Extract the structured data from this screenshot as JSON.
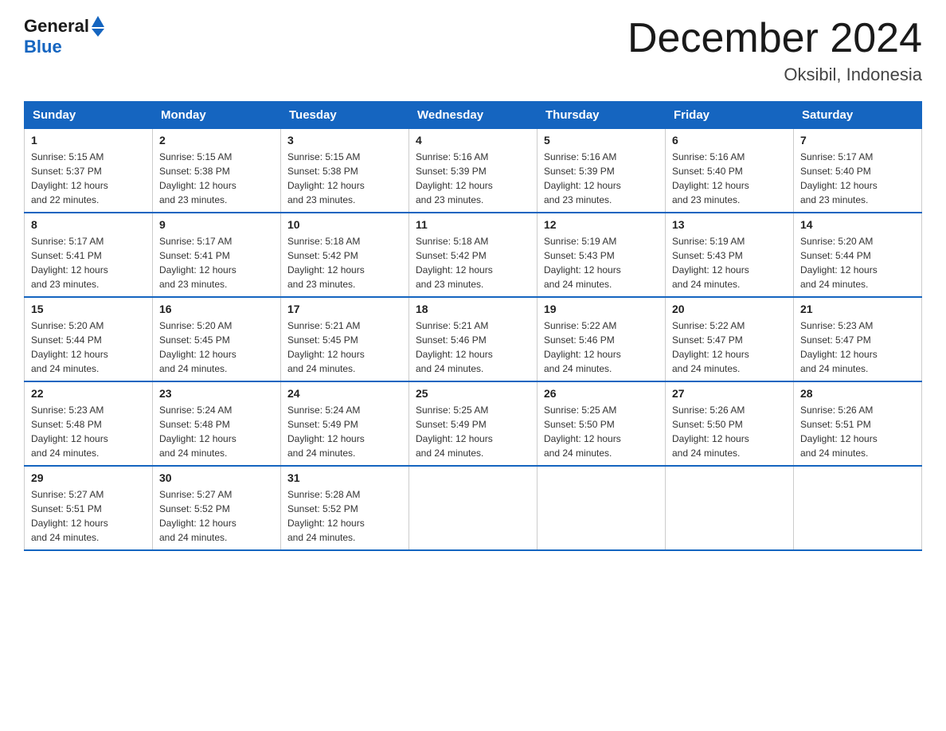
{
  "header": {
    "logo": {
      "general": "General",
      "blue": "Blue"
    },
    "title": "December 2024",
    "location": "Oksibil, Indonesia"
  },
  "days_of_week": [
    "Sunday",
    "Monday",
    "Tuesday",
    "Wednesday",
    "Thursday",
    "Friday",
    "Saturday"
  ],
  "weeks": [
    [
      {
        "day": "1",
        "sunrise": "5:15 AM",
        "sunset": "5:37 PM",
        "daylight": "12 hours and 22 minutes."
      },
      {
        "day": "2",
        "sunrise": "5:15 AM",
        "sunset": "5:38 PM",
        "daylight": "12 hours and 23 minutes."
      },
      {
        "day": "3",
        "sunrise": "5:15 AM",
        "sunset": "5:38 PM",
        "daylight": "12 hours and 23 minutes."
      },
      {
        "day": "4",
        "sunrise": "5:16 AM",
        "sunset": "5:39 PM",
        "daylight": "12 hours and 23 minutes."
      },
      {
        "day": "5",
        "sunrise": "5:16 AM",
        "sunset": "5:39 PM",
        "daylight": "12 hours and 23 minutes."
      },
      {
        "day": "6",
        "sunrise": "5:16 AM",
        "sunset": "5:40 PM",
        "daylight": "12 hours and 23 minutes."
      },
      {
        "day": "7",
        "sunrise": "5:17 AM",
        "sunset": "5:40 PM",
        "daylight": "12 hours and 23 minutes."
      }
    ],
    [
      {
        "day": "8",
        "sunrise": "5:17 AM",
        "sunset": "5:41 PM",
        "daylight": "12 hours and 23 minutes."
      },
      {
        "day": "9",
        "sunrise": "5:17 AM",
        "sunset": "5:41 PM",
        "daylight": "12 hours and 23 minutes."
      },
      {
        "day": "10",
        "sunrise": "5:18 AM",
        "sunset": "5:42 PM",
        "daylight": "12 hours and 23 minutes."
      },
      {
        "day": "11",
        "sunrise": "5:18 AM",
        "sunset": "5:42 PM",
        "daylight": "12 hours and 23 minutes."
      },
      {
        "day": "12",
        "sunrise": "5:19 AM",
        "sunset": "5:43 PM",
        "daylight": "12 hours and 24 minutes."
      },
      {
        "day": "13",
        "sunrise": "5:19 AM",
        "sunset": "5:43 PM",
        "daylight": "12 hours and 24 minutes."
      },
      {
        "day": "14",
        "sunrise": "5:20 AM",
        "sunset": "5:44 PM",
        "daylight": "12 hours and 24 minutes."
      }
    ],
    [
      {
        "day": "15",
        "sunrise": "5:20 AM",
        "sunset": "5:44 PM",
        "daylight": "12 hours and 24 minutes."
      },
      {
        "day": "16",
        "sunrise": "5:20 AM",
        "sunset": "5:45 PM",
        "daylight": "12 hours and 24 minutes."
      },
      {
        "day": "17",
        "sunrise": "5:21 AM",
        "sunset": "5:45 PM",
        "daylight": "12 hours and 24 minutes."
      },
      {
        "day": "18",
        "sunrise": "5:21 AM",
        "sunset": "5:46 PM",
        "daylight": "12 hours and 24 minutes."
      },
      {
        "day": "19",
        "sunrise": "5:22 AM",
        "sunset": "5:46 PM",
        "daylight": "12 hours and 24 minutes."
      },
      {
        "day": "20",
        "sunrise": "5:22 AM",
        "sunset": "5:47 PM",
        "daylight": "12 hours and 24 minutes."
      },
      {
        "day": "21",
        "sunrise": "5:23 AM",
        "sunset": "5:47 PM",
        "daylight": "12 hours and 24 minutes."
      }
    ],
    [
      {
        "day": "22",
        "sunrise": "5:23 AM",
        "sunset": "5:48 PM",
        "daylight": "12 hours and 24 minutes."
      },
      {
        "day": "23",
        "sunrise": "5:24 AM",
        "sunset": "5:48 PM",
        "daylight": "12 hours and 24 minutes."
      },
      {
        "day": "24",
        "sunrise": "5:24 AM",
        "sunset": "5:49 PM",
        "daylight": "12 hours and 24 minutes."
      },
      {
        "day": "25",
        "sunrise": "5:25 AM",
        "sunset": "5:49 PM",
        "daylight": "12 hours and 24 minutes."
      },
      {
        "day": "26",
        "sunrise": "5:25 AM",
        "sunset": "5:50 PM",
        "daylight": "12 hours and 24 minutes."
      },
      {
        "day": "27",
        "sunrise": "5:26 AM",
        "sunset": "5:50 PM",
        "daylight": "12 hours and 24 minutes."
      },
      {
        "day": "28",
        "sunrise": "5:26 AM",
        "sunset": "5:51 PM",
        "daylight": "12 hours and 24 minutes."
      }
    ],
    [
      {
        "day": "29",
        "sunrise": "5:27 AM",
        "sunset": "5:51 PM",
        "daylight": "12 hours and 24 minutes."
      },
      {
        "day": "30",
        "sunrise": "5:27 AM",
        "sunset": "5:52 PM",
        "daylight": "12 hours and 24 minutes."
      },
      {
        "day": "31",
        "sunrise": "5:28 AM",
        "sunset": "5:52 PM",
        "daylight": "12 hours and 24 minutes."
      },
      null,
      null,
      null,
      null
    ]
  ],
  "labels": {
    "sunrise": "Sunrise:",
    "sunset": "Sunset:",
    "daylight": "Daylight:"
  }
}
